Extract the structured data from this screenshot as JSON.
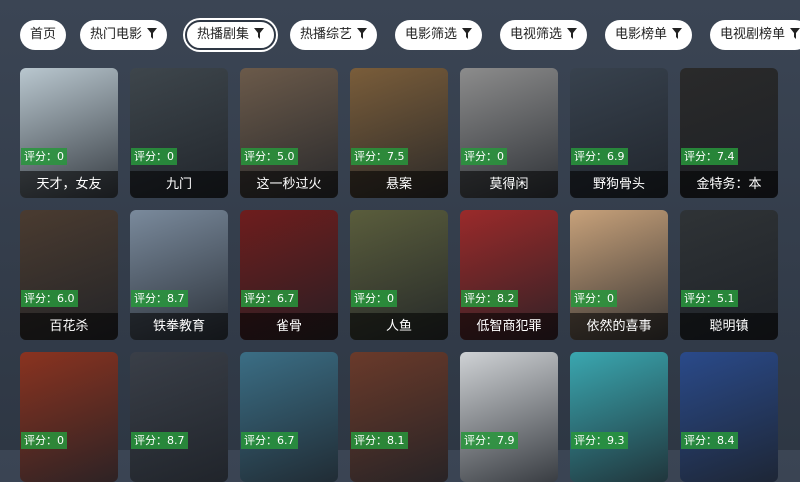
{
  "tabs": [
    {
      "label": "首页",
      "filter": false,
      "active": false
    },
    {
      "label": "热门电影",
      "filter": true,
      "active": false
    },
    {
      "label": "热播剧集",
      "filter": true,
      "active": true
    },
    {
      "label": "热播综艺",
      "filter": true,
      "active": false
    },
    {
      "label": "电影筛选",
      "filter": true,
      "active": false
    },
    {
      "label": "电视筛选",
      "filter": true,
      "active": false
    },
    {
      "label": "电影榜单",
      "filter": true,
      "active": false
    },
    {
      "label": "电视剧榜单",
      "filter": true,
      "active": false
    }
  ],
  "cards": [
    {
      "title": "天才，女友",
      "rating": "评分：0",
      "color": "#b9c7cf"
    },
    {
      "title": "九门",
      "rating": "评分：0",
      "color": "#3e464c"
    },
    {
      "title": "这一秒过火",
      "rating": "评分：5.0",
      "color": "#6b5a4a"
    },
    {
      "title": "悬案",
      "rating": "评分：7.5",
      "color": "#7a5d3a"
    },
    {
      "title": "莫得闲",
      "rating": "评分：0",
      "color": "#8c8c8c"
    },
    {
      "title": "野狗骨头",
      "rating": "评分：6.9",
      "color": "#38424e"
    },
    {
      "title": "金特务：本",
      "rating": "评分：7.4",
      "color": "#2a2a2a"
    },
    {
      "title": "百花杀",
      "rating": "评分：6.0",
      "color": "#4a3b30"
    },
    {
      "title": "铁拳教育",
      "rating": "评分：8.7",
      "color": "#7a8a9c"
    },
    {
      "title": "雀骨",
      "rating": "评分：6.7",
      "color": "#6e1d1d"
    },
    {
      "title": "人鱼",
      "rating": "评分：0",
      "color": "#5a5d3c"
    },
    {
      "title": "低智商犯罪",
      "rating": "评分：8.2",
      "color": "#9a2a2a"
    },
    {
      "title": "依然的喜事",
      "rating": "评分：0",
      "color": "#c7a17a"
    },
    {
      "title": "聪明镇",
      "rating": "评分：5.1",
      "color": "#2f3336"
    },
    {
      "title": "",
      "rating": "评分：0",
      "color": "#8a3320"
    },
    {
      "title": "",
      "rating": "评分：8.7",
      "color": "#3a3f48"
    },
    {
      "title": "",
      "rating": "评分：6.7",
      "color": "#3b6e85"
    },
    {
      "title": "",
      "rating": "评分：8.1",
      "color": "#6a3a2a"
    },
    {
      "title": "",
      "rating": "评分：7.9",
      "color": "#cfd2d5"
    },
    {
      "title": "",
      "rating": "评分：9.3",
      "color": "#3aa7b0"
    },
    {
      "title": "",
      "rating": "评分：8.4",
      "color": "#2a4a8a"
    }
  ]
}
